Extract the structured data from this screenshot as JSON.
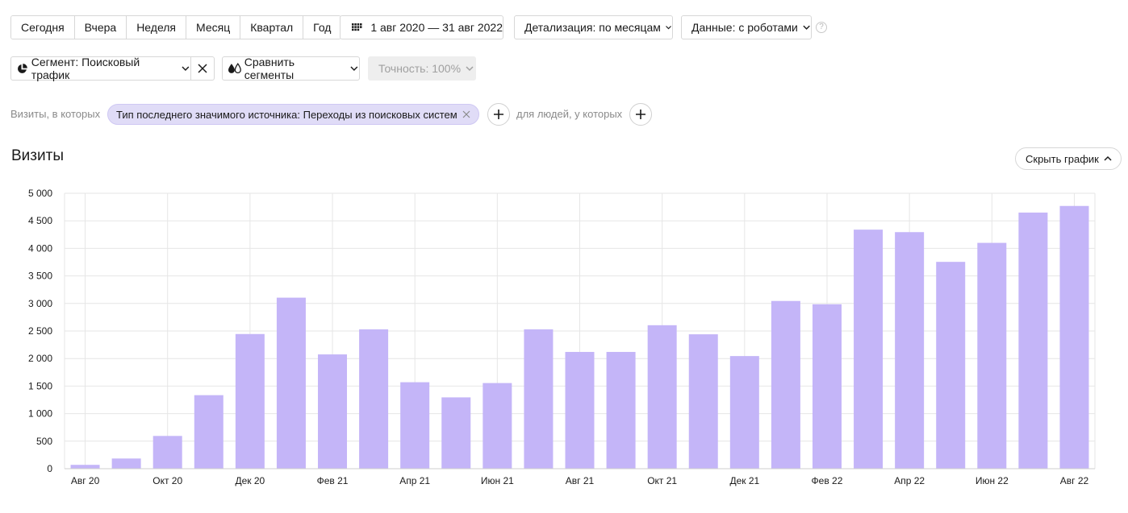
{
  "period_buttons": [
    "Сегодня",
    "Вчера",
    "Неделя",
    "Месяц",
    "Квартал",
    "Год"
  ],
  "date_range": "1 авг 2020 — 31 авг 2022",
  "detail_label": "Детализация: по месяцам",
  "data_label": "Данные: с роботами",
  "help_icon": "?",
  "segment_label": "Сегмент: Поисковый трафик",
  "compare_label": "Сравнить сегменты",
  "accuracy_label": "Точность: 100%",
  "filter": {
    "prefix": "Визиты, в которых",
    "chip": "Тип последнего значимого источника: Переходы из поисковых систем",
    "people": "для людей, у которых"
  },
  "chart_title": "Визиты",
  "hide_chart_label": "Скрыть график",
  "colors": {
    "bar": "#c4b5f8",
    "grid": "#e6e6e6",
    "chip": "#e0dcf7"
  },
  "chart_data": {
    "type": "bar",
    "title": "Визиты",
    "categories": [
      "Авг 20",
      "Сен 20",
      "Окт 20",
      "Ноя 20",
      "Дек 20",
      "Янв 21",
      "Фев 21",
      "Мар 21",
      "Апр 21",
      "Май 21",
      "Июн 21",
      "Июл 21",
      "Авг 21",
      "Сен 21",
      "Окт 21",
      "Ноя 21",
      "Дек 21",
      "Янв 22",
      "Фев 22",
      "Мар 22",
      "Апр 22",
      "Май 22",
      "Июн 22",
      "Июл 22",
      "Авг 22"
    ],
    "tick_labels": [
      "Авг 20",
      "Окт 20",
      "Дек 20",
      "Фев 21",
      "Апр 21",
      "Июн 21",
      "Авг 21",
      "Окт 21",
      "Дек 21",
      "Фев 22",
      "Апр 22",
      "Июн 22",
      "Авг 22"
    ],
    "values": [
      70,
      185,
      595,
      1335,
      2445,
      3105,
      2075,
      2530,
      1570,
      1295,
      1555,
      2530,
      2120,
      2120,
      2605,
      2440,
      2045,
      3045,
      2985,
      4340,
      4295,
      3755,
      4100,
      4650,
      4770
    ],
    "ylim": [
      0,
      5000
    ],
    "y_ticks": [
      "0",
      "500",
      "1 000",
      "1 500",
      "2 000",
      "2 500",
      "3 000",
      "3 500",
      "4 000",
      "4 500",
      "5 000"
    ],
    "grid": true
  }
}
